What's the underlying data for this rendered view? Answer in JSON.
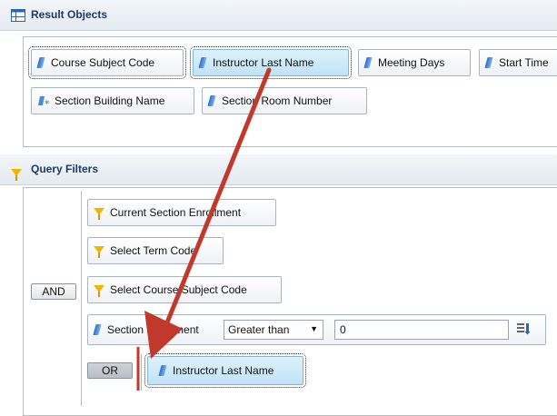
{
  "result_objects": {
    "title": "Result Objects",
    "items": [
      {
        "label": "Course Subject Code"
      },
      {
        "label": "Instructor Last Name"
      },
      {
        "label": "Meeting Days"
      },
      {
        "label": "Start Time"
      },
      {
        "label": "Section Building Name"
      },
      {
        "label": "Section Room Number"
      }
    ]
  },
  "query_filters": {
    "title": "Query Filters",
    "and_label": "AND",
    "or_label": "OR",
    "filters": [
      {
        "label": "Current Section Enrollment"
      },
      {
        "label": "Select Term Code"
      },
      {
        "label": "Select Course Subject Code"
      }
    ],
    "condition": {
      "object": "Section Enrollment",
      "operator": "Greater than",
      "value": "0"
    },
    "or_item": {
      "label": "Instructor Last Name"
    }
  },
  "colors": {
    "arrow": "#c0392b",
    "selected_chip": "#bfe3f6",
    "header": "#e4eaf1"
  }
}
